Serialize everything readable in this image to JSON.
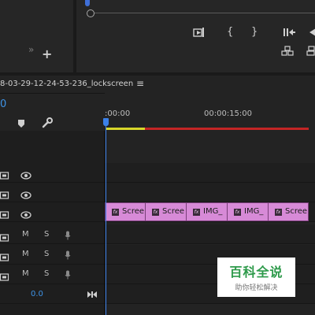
{
  "sequence": {
    "title": "8-03-29-12-24-53-236_lockscreen",
    "menu_glyph": "≡",
    "timecode": "0"
  },
  "ruler": {
    "labels": [
      ":00:00",
      "00:00:15:00"
    ]
  },
  "header_tools": {
    "add_label": "+",
    "expand_glyph": "»"
  },
  "source_controls": {
    "mark_in": "{",
    "mark_out": "}"
  },
  "tracks": {
    "mute_label": "M",
    "solo_label": "S",
    "master_value": "0.0"
  },
  "clips": [
    {
      "name": "Scree",
      "fx": "fx"
    },
    {
      "name": "Scree",
      "fx": "fx"
    },
    {
      "name": "IMG_",
      "fx": "fx"
    },
    {
      "name": "IMG_",
      "fx": "fx"
    },
    {
      "name": "Scree",
      "fx": "fx"
    }
  ],
  "watermark": {
    "main": "百科全说",
    "sub": "助你轻松解决"
  },
  "colors": {
    "clip": "#d78ad7",
    "playhead": "#3b80e8",
    "in_out_yellow": "#d8d62a",
    "in_out_red": "#c32525",
    "watermark_green": "#2d9a4a"
  }
}
